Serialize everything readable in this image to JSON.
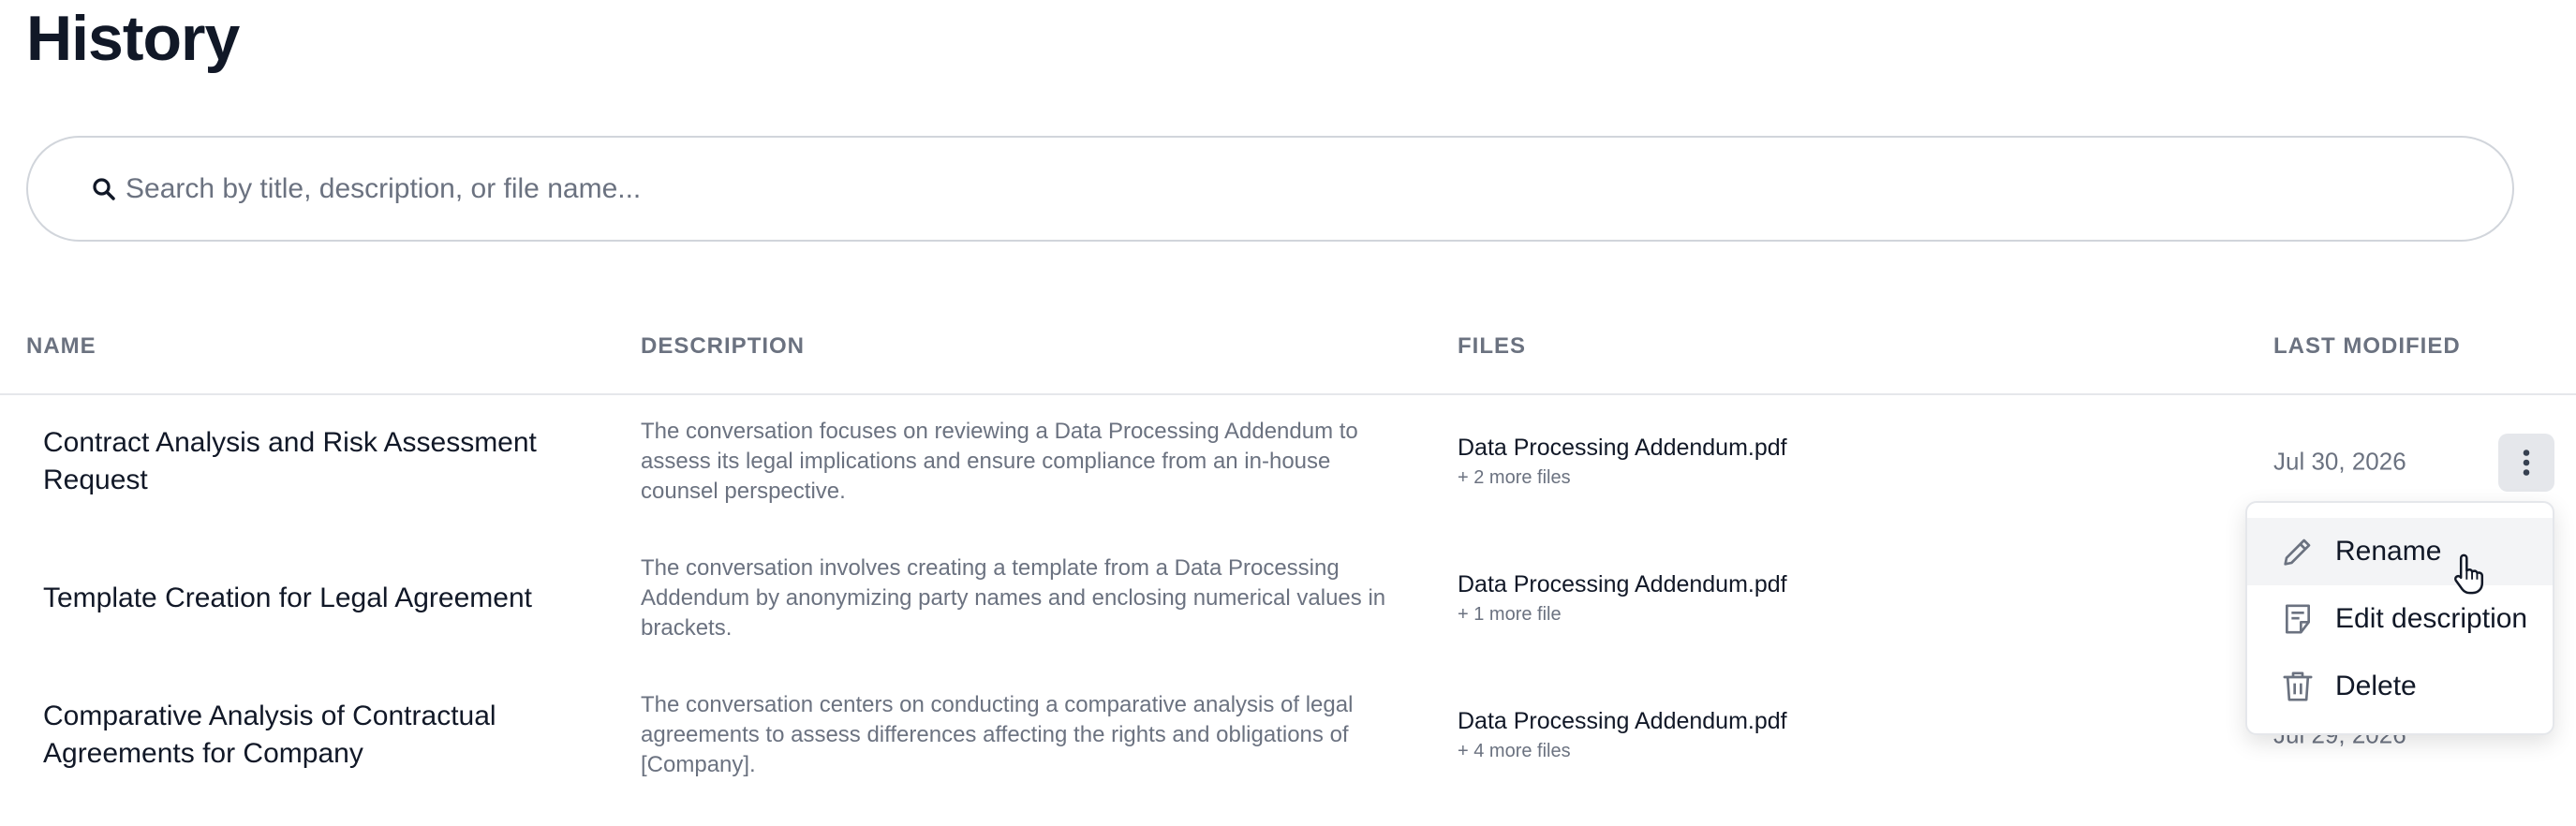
{
  "page": {
    "title": "History"
  },
  "search": {
    "placeholder": "Search by title, description, or file name...",
    "value": "",
    "icon": "search-icon"
  },
  "table": {
    "columns": {
      "name": "NAME",
      "description": "DESCRIPTION",
      "files": "FILES",
      "last_modified": "LAST MODIFIED"
    },
    "rows": [
      {
        "name": "Contract Analysis and Risk Assessment Request",
        "description": "The conversation focuses on reviewing a Data Processing Addendum to assess its legal implications and ensure compliance from an in-house counsel perspective.",
        "file": "Data Processing Addendum.pdf",
        "more_files": "+ 2 more files",
        "date": "Jul 30, 2026"
      },
      {
        "name": "Template Creation for Legal Agreement",
        "description": "The conversation involves creating a template from a Data Processing Addendum by anonymizing party names and enclosing numerical values in brackets.",
        "file": "Data Processing Addendum.pdf",
        "more_files": "+ 1 more file",
        "date": ""
      },
      {
        "name": "Comparative Analysis of Contractual Agreements for Company",
        "description": "The conversation centers on conducting a comparative analysis of legal agreements to assess differences affecting the rights and obligations of [Company].",
        "file": "Data Processing Addendum.pdf",
        "more_files": "+ 4 more files",
        "date": "Jul 29, 2026"
      }
    ]
  },
  "context_menu": {
    "trigger_icon": "more-vertical-icon",
    "items": [
      {
        "label": "Rename",
        "icon": "pencil-icon",
        "hovered": true
      },
      {
        "label": "Edit description",
        "icon": "document-text-icon",
        "hovered": false
      },
      {
        "label": "Delete",
        "icon": "trash-icon",
        "hovered": false
      }
    ]
  },
  "colors": {
    "text_primary": "#111827",
    "text_muted": "#6b7280",
    "border": "#d1d5db",
    "hover_bg": "#f3f4f6",
    "kebab_bg": "#e5e7eb"
  }
}
